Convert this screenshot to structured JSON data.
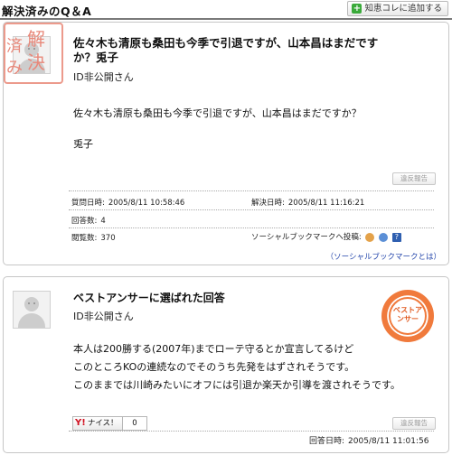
{
  "header": {
    "section_title": "解決済みのQ＆A",
    "add_button_label": "知恵コレに追加する"
  },
  "question": {
    "title": "佐々木も清原も桑田も今季で引退ですが、山本昌はまだですか？兎子",
    "user": "ID非公開さん",
    "body_line1": "佐々木も清原も桑田も今季で引退ですが、山本昌はまだですか？",
    "body_line2": "兎子",
    "stamp_text": "解決済み",
    "report_label": "違反報告",
    "asked_label": "質問日時:",
    "asked_value": "2005/8/11 10:58:46",
    "resolved_label": "解決日時:",
    "resolved_value": "2005/8/11 11:16:21",
    "answers_label": "回答数:",
    "answers_value": "4",
    "views_label": "閲覧数:",
    "views_value": "370",
    "social_post_label": "ソーシャルブックマークへ投稿:",
    "social_help": "?",
    "social_link": "（ソーシャルブックマークとは）"
  },
  "best_answer": {
    "title": "ベストアンサーに選ばれた回答",
    "user": "ID非公開さん",
    "badge_text": "ベストアンサー",
    "line1": "本人は200勝する(2007年)までローテ守るとか宣言してるけど",
    "line2": "このところKOの連続なのでそのうち先発をはずされそうです。",
    "line3": "このままでは川崎みたいにオフには引退か楽天か引導を渡されそうです。",
    "nice_label": "ナイス！",
    "nice_count": "0",
    "report_label": "違反報告",
    "answered_label": "回答日時:",
    "answered_value": "2005/8/11 11:01:56"
  },
  "colors": {
    "stamp": "#e8887a",
    "badge": "#f07a3c",
    "link": "#2244aa"
  }
}
